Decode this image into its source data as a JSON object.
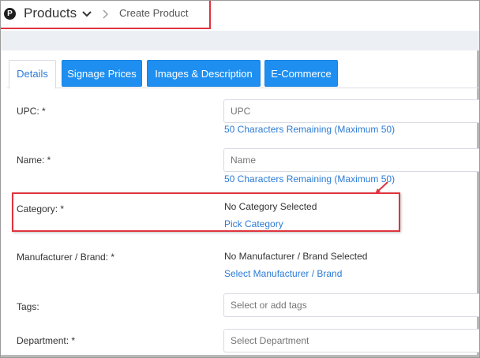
{
  "breadcrumb": {
    "logo_letter": "P",
    "section": "Products",
    "current": "Create Product"
  },
  "tabs": [
    {
      "label": "Details",
      "active": true
    },
    {
      "label": "Signage Prices",
      "active": false
    },
    {
      "label": "Images & Description",
      "active": false
    },
    {
      "label": "E-Commerce",
      "active": false
    }
  ],
  "form": {
    "upc": {
      "label": "UPC: *",
      "placeholder": "UPC",
      "helper": "50 Characters Remaining (Maximum 50)"
    },
    "name": {
      "label": "Name: *",
      "placeholder": "Name",
      "helper": "50 Characters Remaining (Maximum 50)"
    },
    "category": {
      "label": "Category: *",
      "value": "No Category Selected",
      "link": "Pick Category"
    },
    "manufacturer": {
      "label": "Manufacturer / Brand: *",
      "value": "No Manufacturer / Brand Selected",
      "link": "Select Manufacturer / Brand"
    },
    "tags": {
      "label": "Tags:",
      "placeholder": "Select or add tags"
    },
    "department": {
      "label": "Department: *",
      "placeholder": "Select Department"
    }
  },
  "colors": {
    "accent": "#1e8ff0",
    "link": "#2b7bd6",
    "highlight": "#e0343f"
  },
  "icons": {
    "logo": "p-logo-icon",
    "dropdown": "chevron-down-icon",
    "separator": "chevron-right-icon",
    "annotation": "arrow-icon"
  }
}
